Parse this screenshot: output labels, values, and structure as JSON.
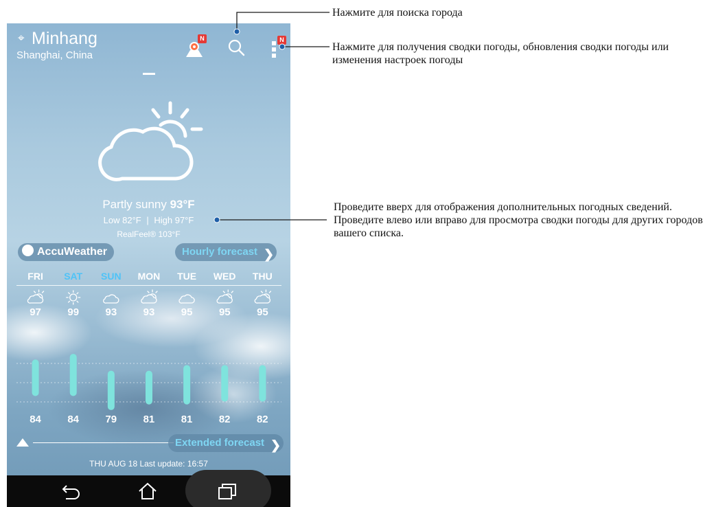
{
  "header": {
    "city": "Minhang",
    "region": "Shanghai, China",
    "map_badge": "N",
    "menu_badge": "N"
  },
  "current": {
    "condition": "Partly sunny",
    "temp": "93°F",
    "low": "Low 82°F",
    "high": "High 97°F",
    "realfeel": "RealFeel® 103°F"
  },
  "buttons": {
    "brand": "AccuWeather",
    "hourly": "Hourly forecast",
    "extended": "Extended forecast"
  },
  "forecast": {
    "days": [
      "FRI",
      "SAT",
      "SUN",
      "MON",
      "TUE",
      "WED",
      "THU"
    ],
    "highs": [
      "97",
      "99",
      "93",
      "93",
      "95",
      "95",
      "95"
    ],
    "lows": [
      "84",
      "84",
      "79",
      "81",
      "81",
      "82",
      "82"
    ],
    "icons": [
      "partly-sunny-icon",
      "sunny-icon",
      "cloudy-icon",
      "partly-sunny-icon",
      "cloudy-icon",
      "partly-sunny-icon",
      "partly-sunny-icon"
    ],
    "weekend_color": "#4fc3f7",
    "bar_color": "#7fe3dd"
  },
  "footer": {
    "last_update": "THU AUG 18 Last update: 16:57"
  },
  "annotations": {
    "search": "Нажмите для поиска города",
    "menu": "Нажмите для получения сводки погоды, обновления сводки погоды или изменения настроек погоды",
    "swipe_line1": "Проведите вверх для отображения дополнительных погодных сведений.",
    "swipe_line2": "Проведите влево или вправо для просмотра сводки погоды для других городов вашего списка."
  }
}
